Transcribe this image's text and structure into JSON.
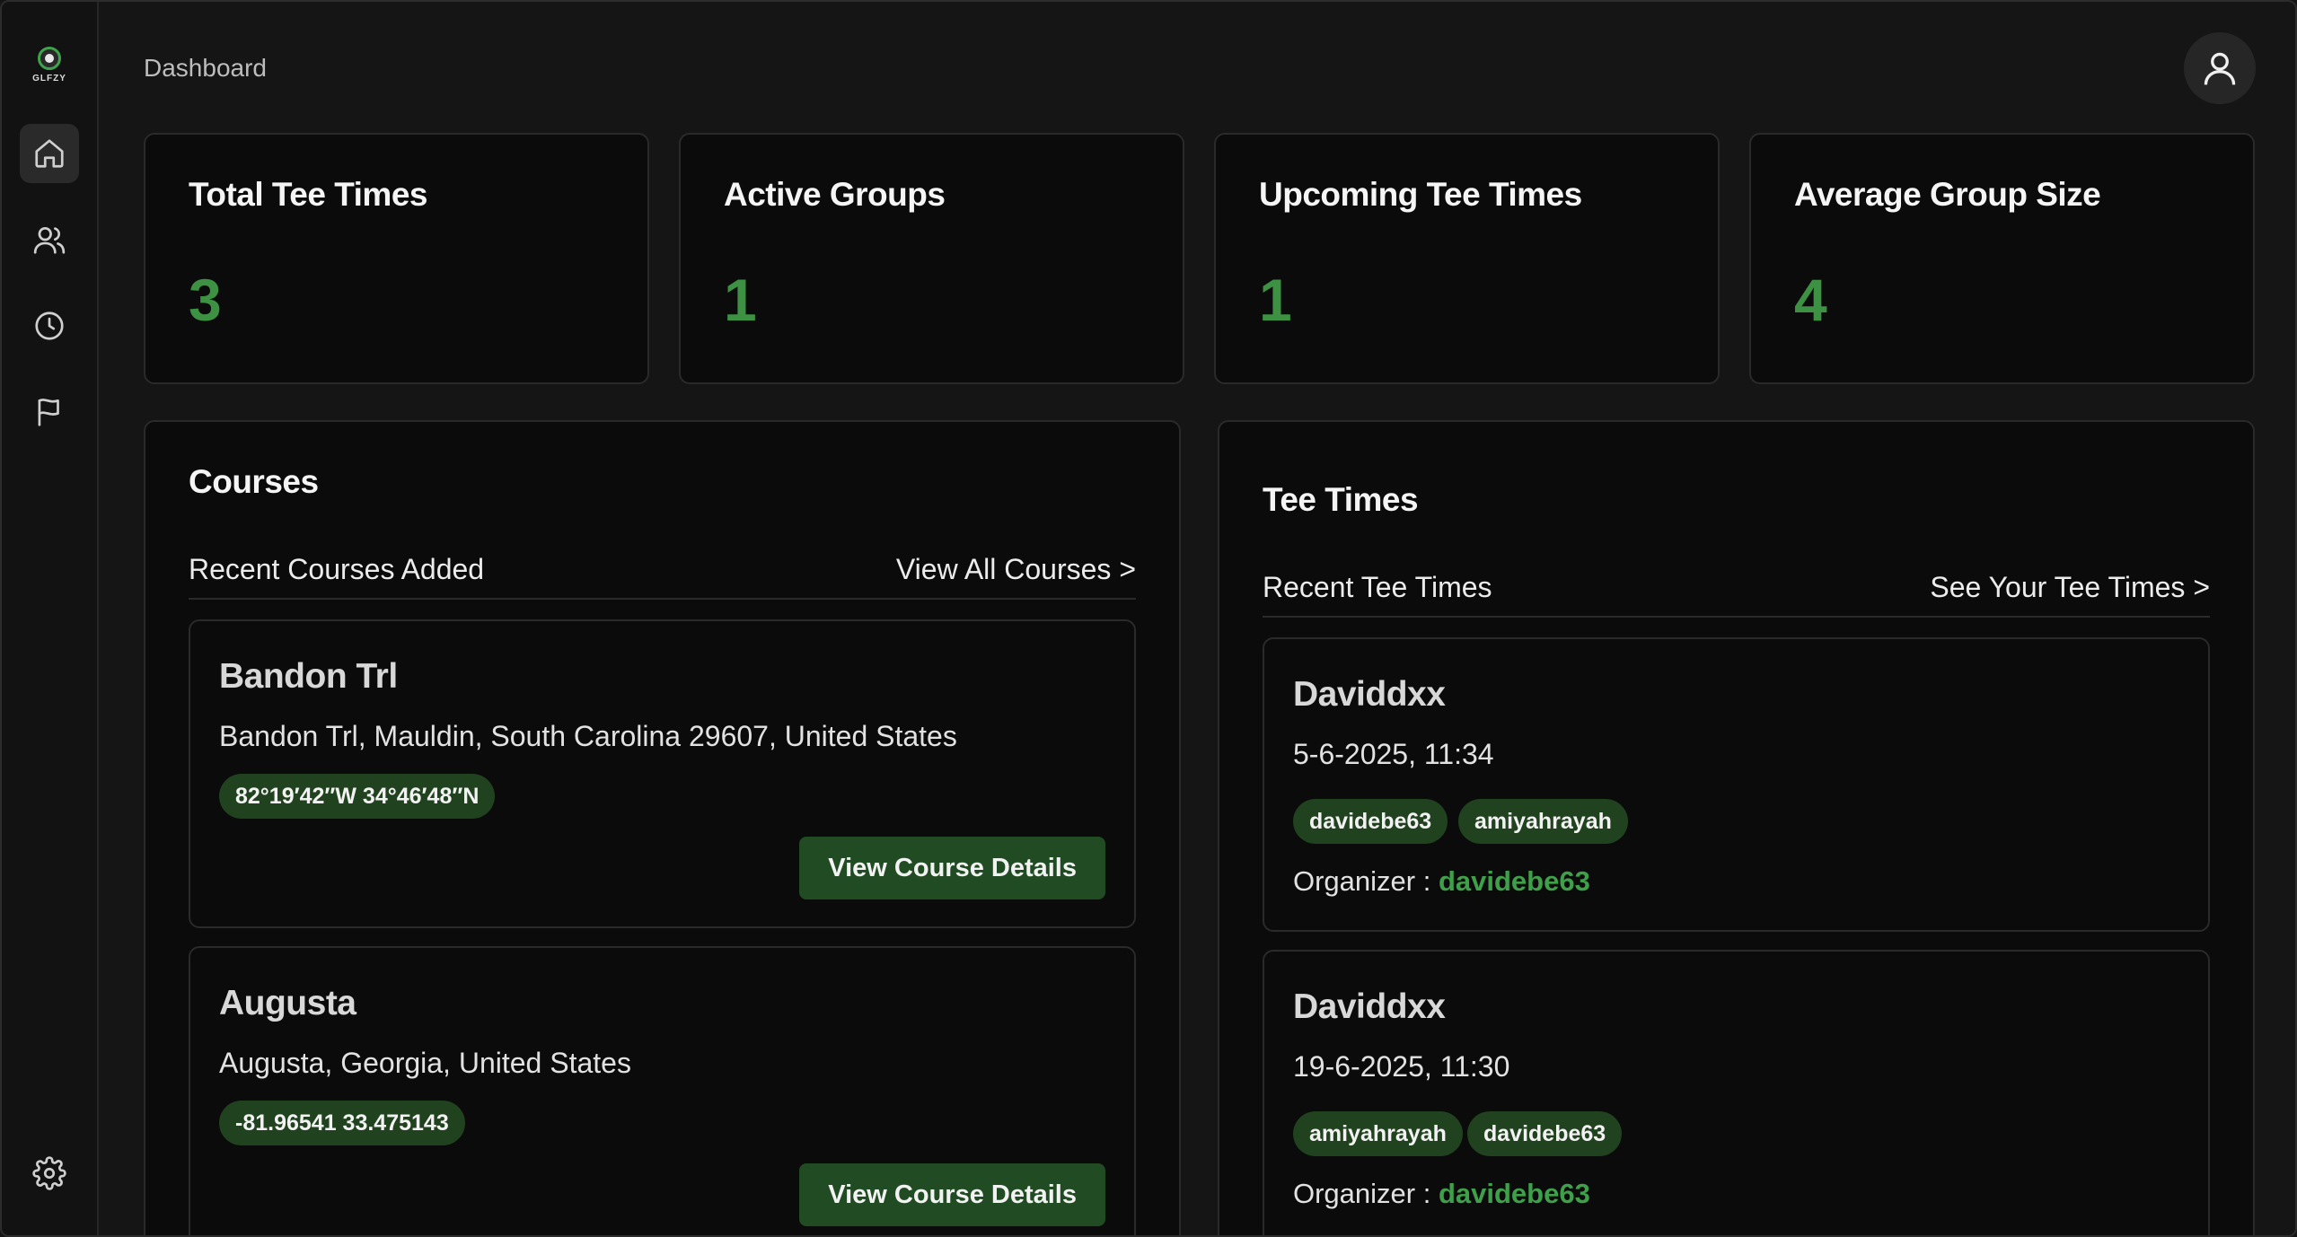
{
  "app": {
    "logo_text": "GLFZY",
    "header_title": "Dashboard"
  },
  "sidebar": {
    "items": [
      {
        "icon": "home-icon",
        "active": true
      },
      {
        "icon": "users-icon",
        "active": false
      },
      {
        "icon": "clock-icon",
        "active": false
      },
      {
        "icon": "flag-icon",
        "active": false
      },
      {
        "icon": "gear-icon",
        "active": false
      }
    ]
  },
  "stats": [
    {
      "title": "Total Tee Times",
      "value": "3"
    },
    {
      "title": "Active Groups",
      "value": "1"
    },
    {
      "title": "Upcoming Tee Times",
      "value": "1"
    },
    {
      "title": "Average Group Size",
      "value": "4"
    }
  ],
  "courses": {
    "title": "Courses",
    "subtitle": "Recent Courses Added",
    "link": "View All Courses >",
    "items": [
      {
        "name": "Bandon Trl",
        "address": "Bandon Trl, Mauldin, South Carolina 29607, United States",
        "coords": "82°19′42″W 34°46′48″N",
        "button": "View Course Details"
      },
      {
        "name": "Augusta",
        "address": "Augusta, Georgia, United States",
        "coords": "-81.96541 33.475143",
        "button": "View Course Details"
      }
    ]
  },
  "tee_times": {
    "title": "Tee Times",
    "subtitle": "Recent Tee Times",
    "link": "See Your Tee Times >",
    "organizer_label": "Organizer :",
    "items": [
      {
        "name": "Daviddxx",
        "datetime": "5-6-2025, 11:34",
        "players": [
          "davidebe63",
          "amiyahrayah"
        ],
        "organizer": "davidebe63"
      },
      {
        "name": "Daviddxx",
        "datetime": "19-6-2025, 11:30",
        "players": [
          "amiyahrayah",
          "davidebe63"
        ],
        "organizer": "davidebe63"
      }
    ]
  },
  "colors": {
    "accent_green": "#3d9142",
    "pill_bg": "#21421f",
    "button_bg": "#214b23",
    "card_bg": "#0b0b0b",
    "page_bg": "#151515"
  }
}
